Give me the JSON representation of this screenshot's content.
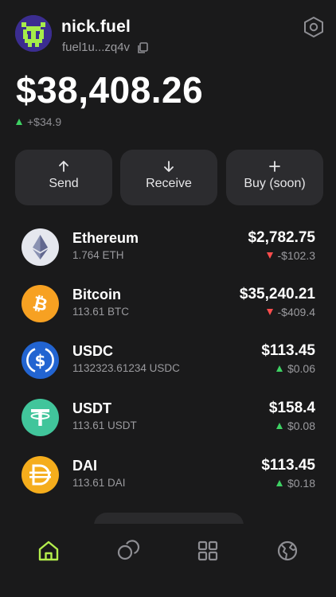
{
  "header": {
    "username": "nick.fuel",
    "address": "fuel1u...zq4v",
    "avatar_icon": "pixel-avatar-icon",
    "copy_icon": "copy-icon",
    "settings_icon": "hexagon-settings-icon"
  },
  "balance": {
    "total": "$38,408.26",
    "change": "+$34.9",
    "change_direction": "up"
  },
  "actions": [
    {
      "label": "Send",
      "icon": "arrow-up-icon"
    },
    {
      "label": "Receive",
      "icon": "arrow-down-icon"
    },
    {
      "label": "Buy (soon)",
      "icon": "plus-icon"
    }
  ],
  "assets": [
    {
      "name": "Ethereum",
      "amount": "1.764 ETH",
      "value": "$2,782.75",
      "change": "-$102.3",
      "direction": "down",
      "icon": "ethereum-icon",
      "color": "#e5e7ee"
    },
    {
      "name": "Bitcoin",
      "amount": "113.61 BTC",
      "value": "$35,240.21",
      "change": "-$409.4",
      "direction": "down",
      "icon": "bitcoin-icon",
      "color": "#f7a122"
    },
    {
      "name": "USDC",
      "amount": "1132323.61234 USDC",
      "value": "$113.45",
      "change": "$0.06",
      "direction": "up",
      "icon": "usdc-icon",
      "color": "#2264d1"
    },
    {
      "name": "USDT",
      "amount": "113.61 USDT",
      "value": "$158.4",
      "change": "$0.08",
      "direction": "up",
      "icon": "usdt-icon",
      "color": "#41c59b"
    },
    {
      "name": "DAI",
      "amount": "113.61 DAI",
      "value": "$113.45",
      "change": "$0.18",
      "direction": "up",
      "icon": "dai-icon",
      "color": "#f5ad1c"
    }
  ],
  "nav": [
    {
      "icon": "home-icon",
      "active": true
    },
    {
      "icon": "coins-icon",
      "active": false
    },
    {
      "icon": "grid-icon",
      "active": false
    },
    {
      "icon": "globe-icon",
      "active": false
    }
  ],
  "colors": {
    "background": "#1a1a1b",
    "card": "#2c2c2f",
    "accent": "#b4ee4d",
    "positive": "#3ed163",
    "negative": "#ff4d4d"
  }
}
